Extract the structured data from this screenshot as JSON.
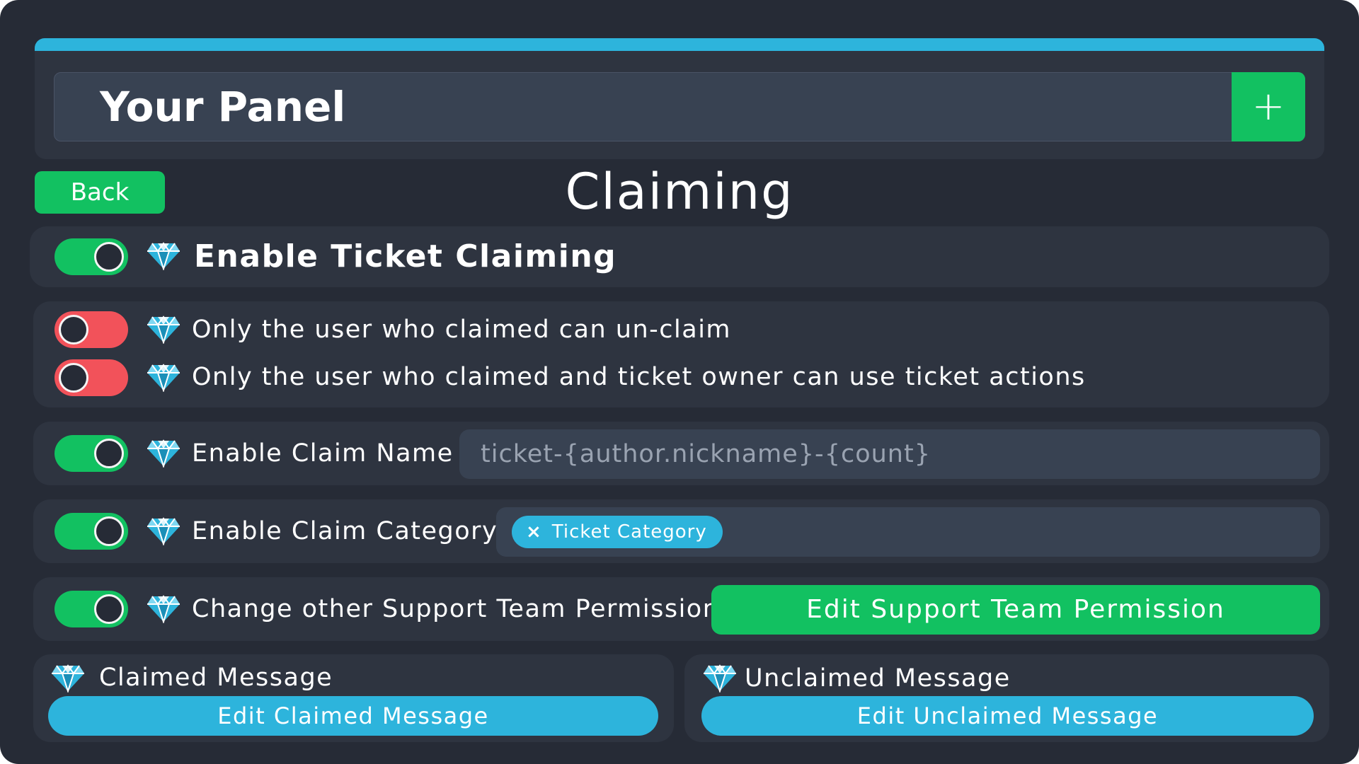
{
  "header": {
    "panel_name": "Your Panel",
    "add_label": "+"
  },
  "nav": {
    "back_label": "Back"
  },
  "page": {
    "title": "Claiming"
  },
  "settings": {
    "enable_claiming": {
      "label": "Enable Ticket Claiming",
      "enabled": true
    },
    "only_claimer_unclaim": {
      "label": "Only the user who claimed can un-claim",
      "enabled": false
    },
    "only_claimer_owner_actions": {
      "label": "Only the user who claimed and ticket owner can use ticket actions",
      "enabled": false
    },
    "claim_name": {
      "label": "Enable Claim Name",
      "enabled": true,
      "placeholder": "ticket-{author.nickname}-{count}"
    },
    "claim_category": {
      "label": "Enable Claim Category",
      "enabled": true,
      "selected": "Ticket Category",
      "remove_icon": "×"
    },
    "support_team": {
      "label": "Change other Support Team Permission",
      "enabled": true,
      "button_label": "Edit Support Team Permission"
    }
  },
  "messages": {
    "claimed": {
      "label": "Claimed Message",
      "button_label": "Edit Claimed Message"
    },
    "unclaimed": {
      "label": "Unclaimed Message",
      "button_label": "Edit Unclaimed Message"
    }
  },
  "icons": {
    "premium": "gem-icon"
  },
  "colors": {
    "background": "#262b36",
    "card": "#2e3440",
    "input": "#384252",
    "accent_blue": "#2db4dc",
    "green": "#12c161",
    "red": "#f2525a"
  }
}
